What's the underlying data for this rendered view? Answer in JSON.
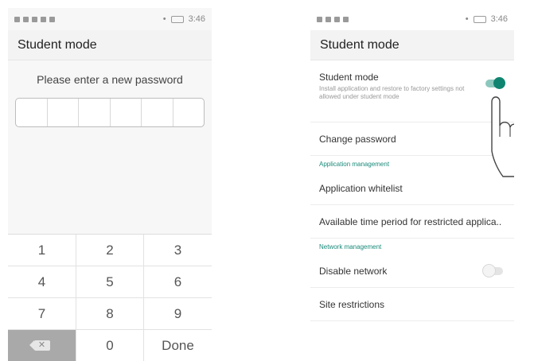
{
  "left": {
    "status_time": "3:46",
    "battery": "",
    "title": "Student mode",
    "prompt": "Please enter a new password",
    "password_cells": 6,
    "keys": [
      "1",
      "2",
      "3",
      "4",
      "5",
      "6",
      "7",
      "8",
      "9",
      "",
      "0",
      "Done"
    ]
  },
  "right": {
    "status_time": "3:46",
    "title": "Student mode",
    "student_mode": {
      "title": "Student mode",
      "description": "Install application and restore to factory settings not allowed under student mode",
      "enabled": true
    },
    "change_password": "Change password",
    "app_section": "Application management",
    "app_whitelist": "Application whitelist",
    "time_period": "Available time period for restricted applica..",
    "network_section": "Network management",
    "disable_network": {
      "label": "Disable network",
      "enabled": false
    },
    "site_restrictions": "Site restrictions"
  },
  "colors": {
    "accent": "#0f8571",
    "section_text": "#1a8a7a",
    "delete_key": "#a9a9a9"
  },
  "icons": [
    "wifi-icon",
    "notification-icon",
    "sim-icon",
    "alarm-icon",
    "backspace-icon",
    "tap-hand-icon"
  ]
}
